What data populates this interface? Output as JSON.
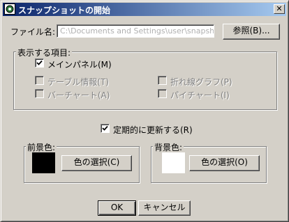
{
  "window": {
    "title": "スナップショットの開始",
    "close_glyph": "✕"
  },
  "file": {
    "label": "ファイル名:",
    "value": "C:\\Documents and Settings\\user\\snapshot.txt",
    "browse_label": "参照(B)..."
  },
  "display_items": {
    "title": "表示する項目:",
    "items": [
      {
        "label": "メインパネル(M)",
        "checked": true,
        "enabled": true
      },
      {
        "label": "テーブル情報(T)",
        "checked": false,
        "enabled": false
      },
      {
        "label": "折れ線グラフ(P)",
        "checked": false,
        "enabled": false
      },
      {
        "label": "バーチャート(A)",
        "checked": false,
        "enabled": false
      },
      {
        "label": "パイチャート(I)",
        "checked": false,
        "enabled": false
      }
    ]
  },
  "periodic_update": {
    "label": "定期的に更新する(R)",
    "checked": true
  },
  "foreground": {
    "title": "前景色:",
    "color": "#000000",
    "button_label": "色の選択(C)"
  },
  "background": {
    "title": "背景色:",
    "color": "#ffffff",
    "button_label": "色の選択(O)"
  },
  "buttons": {
    "ok": "OK",
    "cancel": "キャンセル"
  },
  "colors": {
    "titlebar_start": "#0a246a",
    "titlebar_end": "#a6caf0",
    "face": "#d4d0c8"
  }
}
